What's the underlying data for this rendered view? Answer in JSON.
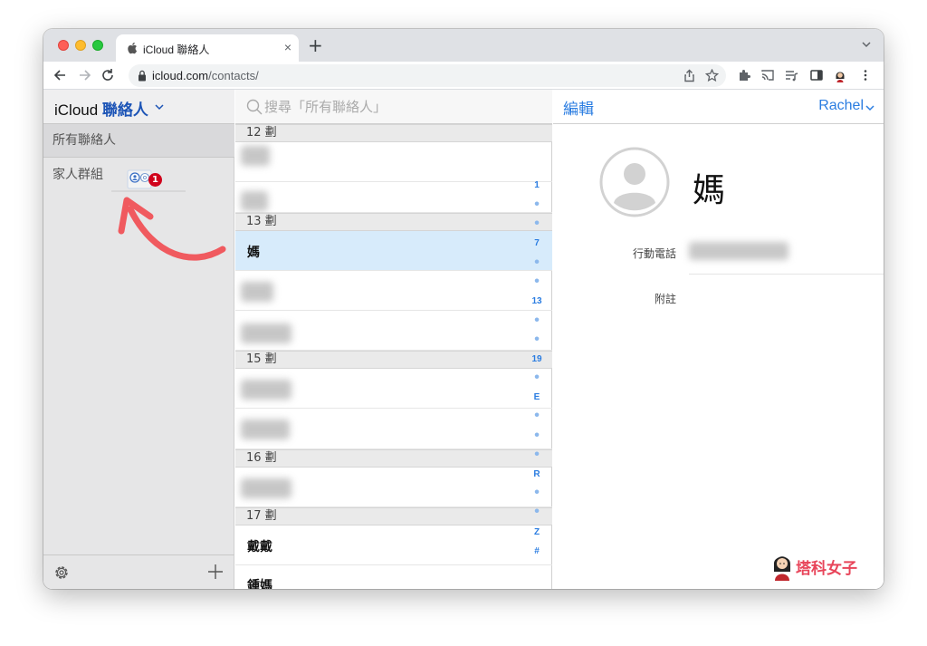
{
  "browser": {
    "tab_title": "iCloud 聯絡人",
    "tab_close": "×",
    "new_tab": "+",
    "url_host": "icloud.com",
    "url_path": "/contacts/"
  },
  "sidebar": {
    "title_prefix": "iCloud ",
    "title_accent": "聯絡人",
    "groups": [
      {
        "label": "所有聯絡人"
      },
      {
        "label": "家人群組"
      }
    ],
    "drag_badge": "1"
  },
  "list": {
    "search_placeholder": "搜尋「所有聯絡人」",
    "sections": [
      "12 劃",
      "13 劃",
      "15 劃",
      "16 劃",
      "17 劃"
    ],
    "contacts": [
      {
        "name": ""
      },
      {
        "name": ""
      },
      {
        "name": "媽"
      },
      {
        "name": ""
      },
      {
        "name": ""
      },
      {
        "name": ""
      },
      {
        "name": ""
      },
      {
        "name": ""
      },
      {
        "name": "戴戴"
      },
      {
        "name": "鍾媽"
      }
    ],
    "index": [
      "1",
      "7",
      "13",
      "19",
      "E",
      "R",
      "Z",
      "#"
    ]
  },
  "detail": {
    "edit_label": "編輯",
    "user_label": "Rachel",
    "contact_name": "媽",
    "mobile_label": "行動電話",
    "note_label": "附註"
  },
  "watermark": {
    "text": "塔科女子"
  },
  "colors": {
    "accent": "#2b7de1",
    "title_accent": "#1c54b6",
    "selected_row": "#d7ebfb",
    "badge": "#d0021b",
    "arrow": "#f05a5f"
  }
}
